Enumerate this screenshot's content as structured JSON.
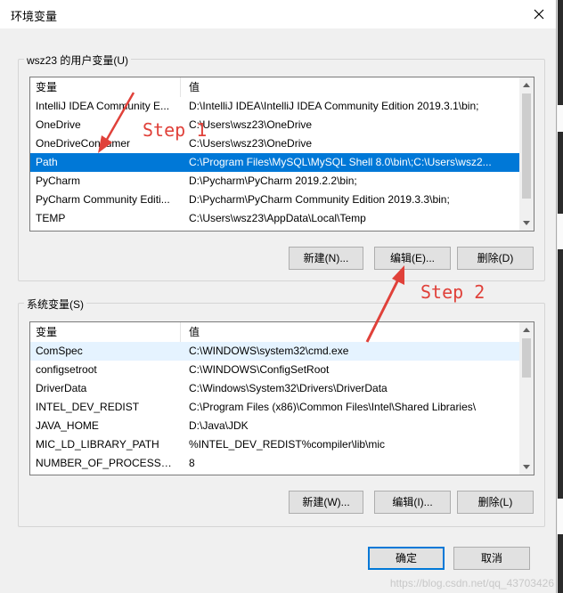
{
  "window": {
    "title": "环境变量"
  },
  "user_vars": {
    "group_label": "wsz23 的用户变量(U)",
    "columns": [
      "变量",
      "值"
    ],
    "rows": [
      {
        "name": "IntelliJ IDEA Community E...",
        "value": "D:\\IntelliJ IDEA\\IntelliJ IDEA Community Edition 2019.3.1\\bin;"
      },
      {
        "name": "OneDrive",
        "value": "C:\\Users\\wsz23\\OneDrive"
      },
      {
        "name": "OneDriveConsumer",
        "value": "C:\\Users\\wsz23\\OneDrive"
      },
      {
        "name": "Path",
        "value": "C:\\Program Files\\MySQL\\MySQL Shell 8.0\\bin\\;C:\\Users\\wsz2..."
      },
      {
        "name": "PyCharm",
        "value": "D:\\Pycharm\\PyCharm 2019.2.2\\bin;"
      },
      {
        "name": "PyCharm Community Editi...",
        "value": "D:\\Pycharm\\PyCharm Community Edition 2019.3.3\\bin;"
      },
      {
        "name": "TEMP",
        "value": "C:\\Users\\wsz23\\AppData\\Local\\Temp"
      }
    ],
    "selected_index": 3,
    "buttons": {
      "new": "新建(N)...",
      "edit": "编辑(E)...",
      "delete": "删除(D)"
    }
  },
  "system_vars": {
    "group_label": "系统变量(S)",
    "columns": [
      "变量",
      "值"
    ],
    "rows": [
      {
        "name": "ComSpec",
        "value": "C:\\WINDOWS\\system32\\cmd.exe"
      },
      {
        "name": "configsetroot",
        "value": "C:\\WINDOWS\\ConfigSetRoot"
      },
      {
        "name": "DriverData",
        "value": "C:\\Windows\\System32\\Drivers\\DriverData"
      },
      {
        "name": "INTEL_DEV_REDIST",
        "value": "C:\\Program Files (x86)\\Common Files\\Intel\\Shared Libraries\\"
      },
      {
        "name": "JAVA_HOME",
        "value": "D:\\Java\\JDK"
      },
      {
        "name": "MIC_LD_LIBRARY_PATH",
        "value": "%INTEL_DEV_REDIST%compiler\\lib\\mic"
      },
      {
        "name": "NUMBER_OF_PROCESSORS",
        "value": "8"
      }
    ],
    "buttons": {
      "new": "新建(W)...",
      "edit": "编辑(I)...",
      "delete": "删除(L)"
    }
  },
  "footer": {
    "ok": "确定",
    "cancel": "取消"
  },
  "annotations": {
    "step1": "Step 1",
    "step2": "Step 2",
    "color": "#e0413a"
  },
  "watermark": "https://blog.csdn.net/qq_43703426",
  "colors": {
    "selection": "#0078d7",
    "hover": "#e5f3ff",
    "default_button_border": "#0078d7"
  }
}
